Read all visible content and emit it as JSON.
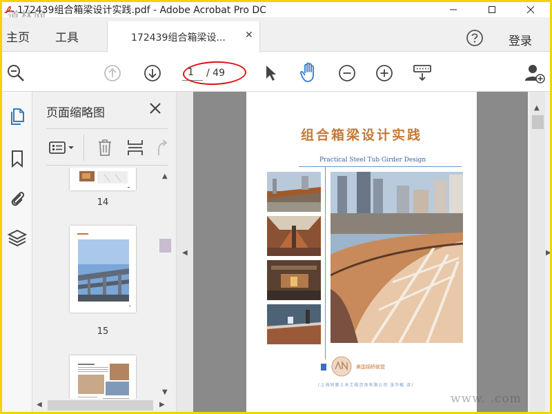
{
  "window": {
    "title": "172439组合箱梁设计实践.pdf - Adobe Acrobat Pro DC",
    "watermark_top": "道林网",
    "watermark_bottom": "www.      .com"
  },
  "tabbar": {
    "home": "主页",
    "tools": "工具",
    "doc_tab": "172439组合箱梁设...",
    "login": "登录"
  },
  "toolbar": {
    "current_page": "1",
    "total_pages": "/ 49"
  },
  "panel": {
    "title": "页面缩略图",
    "thumbnails": [
      {
        "label": "14"
      },
      {
        "label": "15"
      },
      {
        "label": ""
      }
    ]
  },
  "document": {
    "title": "组合箱梁设计实践",
    "subtitle": "Practical Steel Tub Girder Design",
    "publisher": "美国钢桥联盟",
    "translator": "(上海同豪土木工程咨询有限公司 张华敏 译)"
  },
  "colors": {
    "accent_orange": "#c47a36",
    "accent_blue": "#3b5f9c",
    "highlight_red": "#e01010",
    "doc_background": "#8a8a8a"
  }
}
